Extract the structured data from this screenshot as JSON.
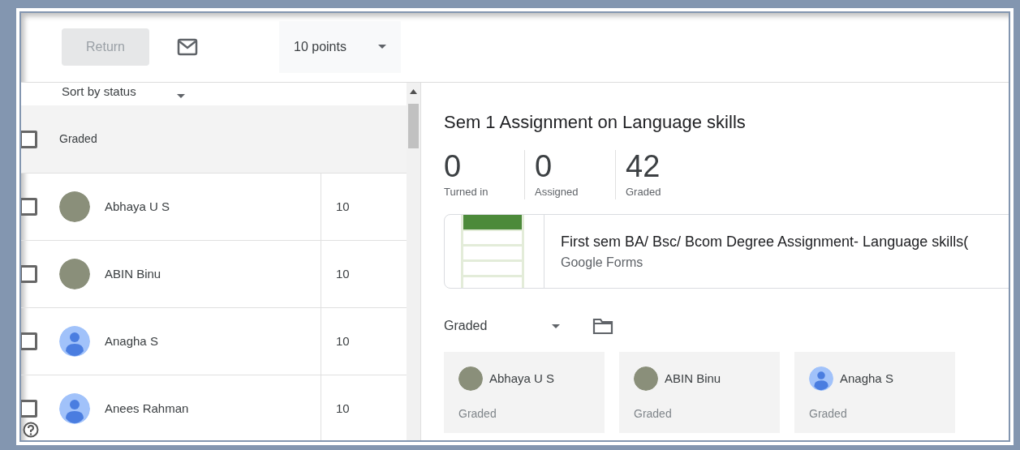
{
  "toolbar": {
    "return_button": {
      "label": "Return",
      "disabled": true
    },
    "points_dropdown": {
      "value": "10 points"
    }
  },
  "student_list": {
    "sort_dropdown": {
      "value": "Sort by status"
    },
    "group": {
      "label": "Graded",
      "checked": false
    },
    "students": [
      {
        "name": "Abhaya U S",
        "grade": "10",
        "kind": "photo",
        "checked": false
      },
      {
        "name": "ABIN Binu",
        "grade": "10",
        "kind": "photo",
        "checked": false
      },
      {
        "name": "Anagha S",
        "grade": "10",
        "kind": "default",
        "checked": false
      },
      {
        "name": "Anees Rahman",
        "grade": "10",
        "kind": "default",
        "checked": false
      }
    ]
  },
  "assignment": {
    "title": "Sem 1 Assignment on Language skills",
    "stats": [
      {
        "count": "0",
        "label": "Turned in"
      },
      {
        "count": "0",
        "label": "Assigned"
      },
      {
        "count": "42",
        "label": "Graded"
      }
    ],
    "attachment": {
      "title": "First sem BA/ Bsc/ Bcom Degree Assignment- Language skills(",
      "source": "Google Forms"
    },
    "filter_dropdown": {
      "value": "Graded"
    },
    "cards": [
      {
        "name": "Abhaya U S",
        "kind": "photo",
        "status": "Graded"
      },
      {
        "name": "ABIN Binu",
        "kind": "photo",
        "status": "Graded"
      },
      {
        "name": "Anagha S",
        "kind": "default",
        "status": "Graded"
      }
    ]
  }
}
